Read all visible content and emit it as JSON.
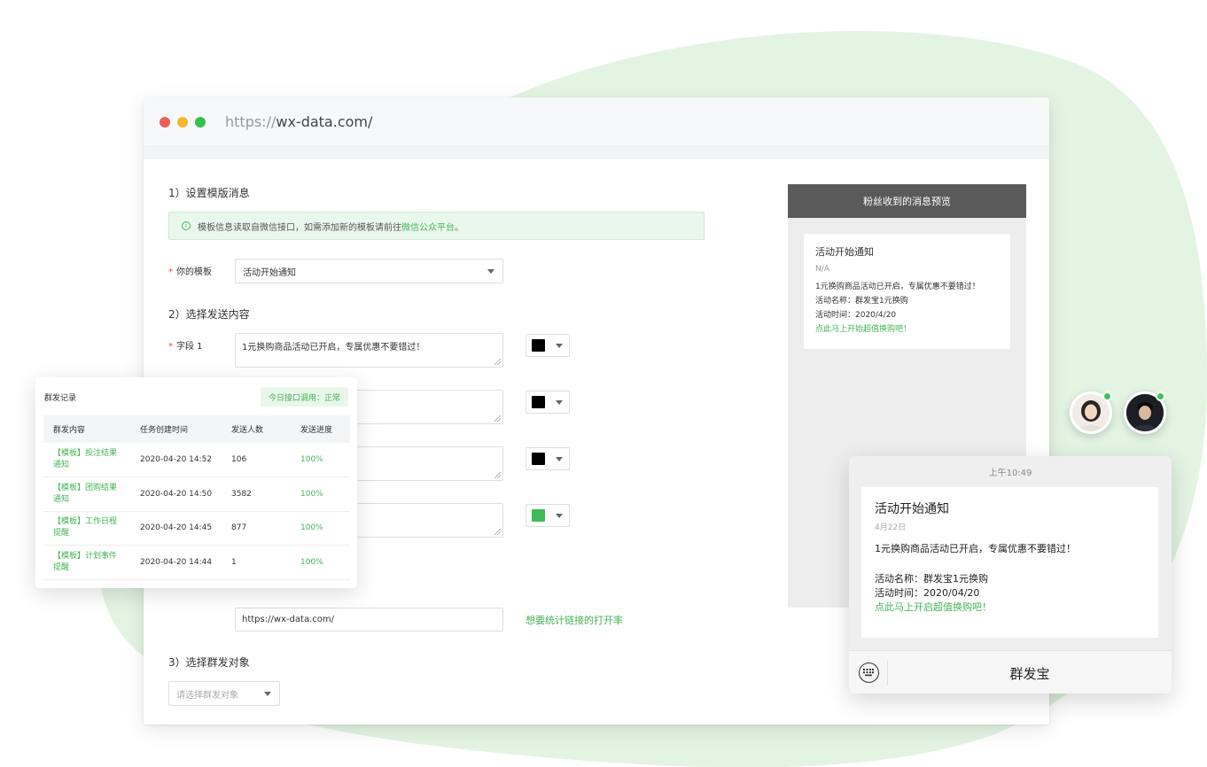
{
  "browser": {
    "url_protocol": "https://",
    "url_host": "wx-data.com/"
  },
  "form": {
    "section1_title": "1）设置模版消息",
    "notice_text": "模板信息读取自微信接口，如需添加新的模板请前往",
    "notice_link": "微信公众平台",
    "notice_end": "。",
    "template_label": "你的模板",
    "template_value": "活动开始通知",
    "section2_title": "2）选择发送内容",
    "field1_label": "字段 1",
    "field1_value": "1元换购商品活动已开启，专属优惠不要错过！",
    "colors": [
      "#000000",
      "#000000",
      "#000000",
      "#3fba56"
    ],
    "link_value": "https://wx-data.com/",
    "stat_link": "想要统计链接的打开率",
    "section3_title": "3）选择群发对象",
    "audience_placeholder": "请选择群发对象"
  },
  "preview": {
    "header": "粉丝收到的消息预览",
    "title": "活动开始通知",
    "date": "N/A",
    "line1": "1元换购商品活动已开启，专属优惠不要错过！",
    "line2": "活动名称：群发宝1元换购",
    "line3": "活动时间：2020/4/20",
    "cta": "点此马上开始超值换购吧！"
  },
  "records": {
    "title": "群发记录",
    "badge": "今日接口调用：正常",
    "columns": [
      "群发内容",
      "任务创建时间",
      "发送人数",
      "发送进度"
    ],
    "rows": [
      {
        "content_a": "【模板】投注结果",
        "content_b": "通知",
        "time": "2020-04-20 14:52",
        "count": "106",
        "progress": "100%"
      },
      {
        "content_a": "【模板】团购结果",
        "content_b": "通知",
        "time": "2020-04-20 14:50",
        "count": "3582",
        "progress": "100%"
      },
      {
        "content_a": "【模板】工作日程",
        "content_b": "提醒",
        "time": "2020-04-20 14:45",
        "count": "877",
        "progress": "100%"
      },
      {
        "content_a": "【模板】计划事件",
        "content_b": "提醒",
        "time": "2020-04-20 14:44",
        "count": "1",
        "progress": "100%"
      }
    ]
  },
  "phone": {
    "time": "上午10:49",
    "title": "活动开始通知",
    "date": "4月22日",
    "line1": "1元换购商品活动已开启，专属优惠不要错过！",
    "line2": "活动名称：群发宝1元换购",
    "line3": "活动时间：2020/04/20",
    "cta": "点此马上开启超值换购吧！",
    "account_name": "群发宝"
  },
  "icons": {
    "notice": "info-icon",
    "keyboard": "keyboard-icon"
  }
}
